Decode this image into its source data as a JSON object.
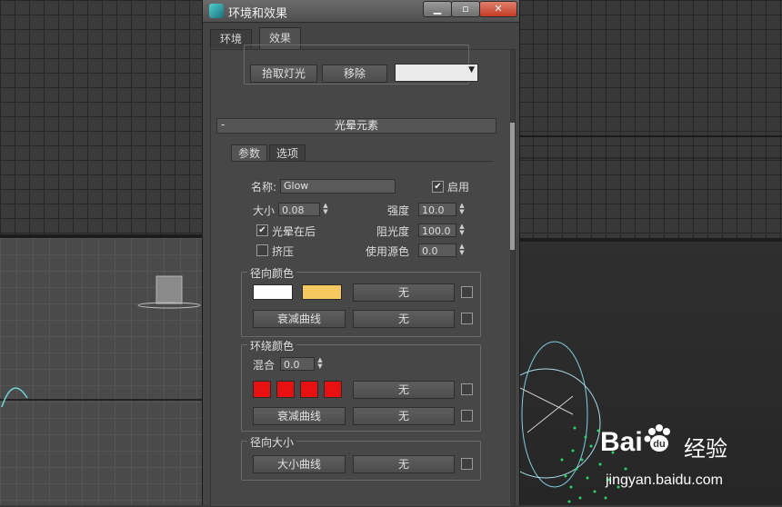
{
  "dialog": {
    "title": "环境和效果",
    "tabs": [
      {
        "label": "环境",
        "active": false
      },
      {
        "label": "效果",
        "active": true
      }
    ]
  },
  "lights_rollout": {
    "pick_light_button": "拾取灯光",
    "remove_button": "移除"
  },
  "glow_rollout": {
    "title": "光晕元素",
    "collapse_symbol": "-",
    "inner_tabs": [
      {
        "label": "参数",
        "active": true
      },
      {
        "label": "选项",
        "active": false
      }
    ],
    "name_label": "名称:",
    "name_value": "Glow",
    "enable_label": "启用",
    "enable_checked": true,
    "size_label": "大小",
    "size_value": "0.08",
    "intensity_label": "强度",
    "intensity_value": "10.0",
    "glow_behind_label": "光晕在后",
    "glow_behind_checked": true,
    "occlusion_label": "阻光度",
    "occlusion_value": "100.0",
    "squeeze_label": "挤压",
    "squeeze_checked": false,
    "use_source_color_label": "使用源色",
    "use_source_color_value": "0.0",
    "radial_color": {
      "title": "径向颜色",
      "swatch_colors": [
        "#ffffff",
        "#f5c860"
      ],
      "map_button": "无",
      "falloff_button": "衰减曲线",
      "falloff_map_button": "无"
    },
    "circular_color": {
      "title": "环绕颜色",
      "mix_label": "混合",
      "mix_value": "0.0",
      "swatch_colors": [
        "#e81010",
        "#e81010",
        "#e81010",
        "#e81010"
      ],
      "map_button": "无",
      "falloff_button": "衰减曲线",
      "falloff_map_button": "无"
    },
    "radial_size": {
      "title": "径向大小",
      "size_curve_button": "大小曲线",
      "map_button": "无"
    }
  },
  "watermark": {
    "brand_bai": "Bai",
    "brand_du": "du",
    "brand_jingyan": "经验",
    "url": "jingyan.baidu.com"
  },
  "colors": {
    "accent_teal": "#4fd2d2",
    "close_red": "#c33b22",
    "particle_green": "#2bd36a"
  }
}
